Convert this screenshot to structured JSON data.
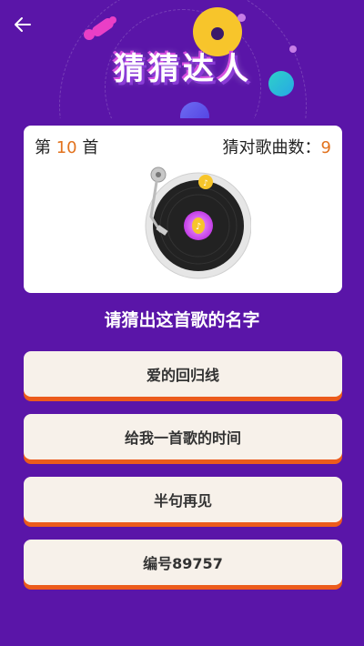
{
  "header": {
    "title": "猜猜达人",
    "back_icon": "arrow-left-icon"
  },
  "level": {
    "prefix": "第",
    "number": "10",
    "suffix": "首"
  },
  "score": {
    "label": "猜对歌曲数：",
    "value": "9"
  },
  "prompt": "请猜出这首歌的名字",
  "options": [
    "爱的回归线",
    "给我一首歌的时间",
    "半句再见",
    "编号89757"
  ],
  "colors": {
    "background": "#5a15a8",
    "accent": "#e2721d",
    "option_shadow": "#ec5b1c"
  }
}
